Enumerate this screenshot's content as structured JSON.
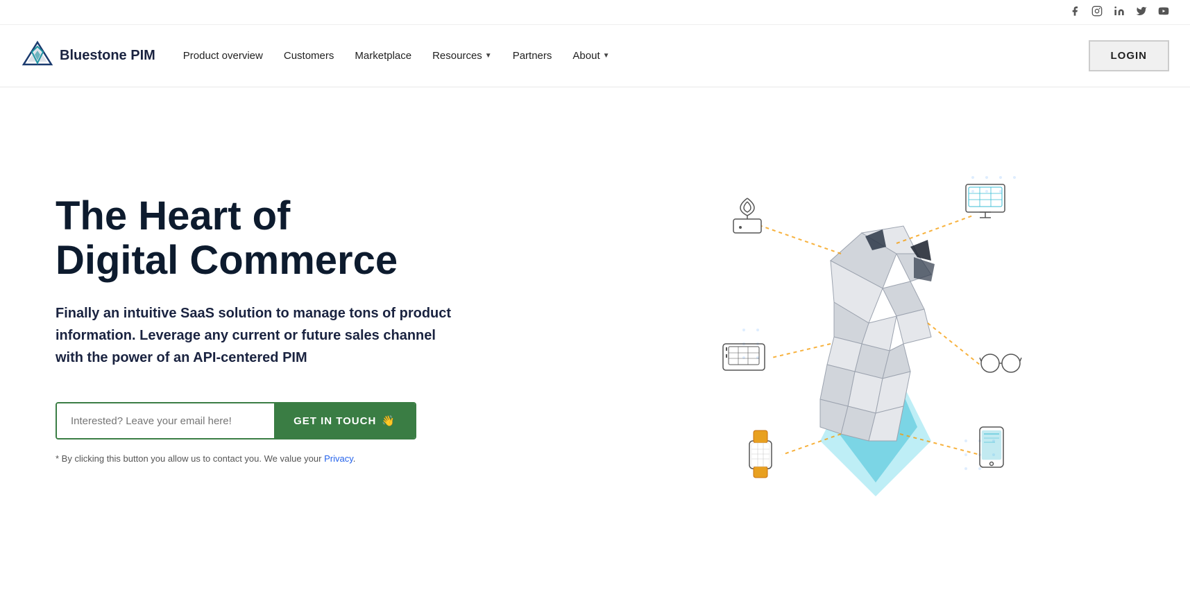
{
  "social": {
    "icons": [
      "facebook",
      "instagram",
      "linkedin",
      "twitter",
      "youtube"
    ]
  },
  "nav": {
    "logo_text": "Bluestone PIM",
    "links": [
      {
        "label": "Product overview",
        "has_dropdown": false
      },
      {
        "label": "Customers",
        "has_dropdown": false
      },
      {
        "label": "Marketplace",
        "has_dropdown": false
      },
      {
        "label": "Resources",
        "has_dropdown": true
      },
      {
        "label": "Partners",
        "has_dropdown": false
      },
      {
        "label": "About",
        "has_dropdown": true
      }
    ],
    "login_label": "LOGIN"
  },
  "hero": {
    "title_line1": "The Heart of",
    "title_line2": "Digital Commerce",
    "subtitle": "Finally an intuitive SaaS solution to manage tons of product information. Leverage any current or future sales channel with the power of an API-centered PIM",
    "cta_placeholder": "Interested? Leave your email here!",
    "cta_button": "GET IN TOUCH",
    "cta_emoji": "👋",
    "disclaimer": "* By clicking this button you allow us to contact you. We value your",
    "privacy_label": "Privacy",
    "period": "."
  }
}
